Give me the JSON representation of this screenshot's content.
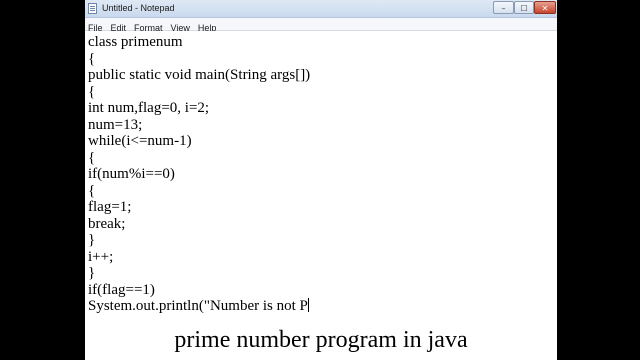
{
  "window": {
    "title": "Untitled - Notepad",
    "controls": {
      "minimize": "–",
      "maximize": "☐",
      "close": "✕"
    }
  },
  "menu": [
    "File",
    "Edit",
    "Format",
    "View",
    "Help"
  ],
  "editor": {
    "lines": [
      "class primenum",
      "{",
      "public static void main(String args[])",
      "{",
      "int num,flag=0, i=2;",
      "num=13;",
      "while(i<=num-1)",
      "{",
      "if(num%i==0)",
      "{",
      "flag=1;",
      "break;",
      "}",
      "i++;",
      "}",
      "if(flag==1)",
      "System.out.println(\"Number is not P"
    ]
  },
  "caption": "prime number program in java",
  "colors": {
    "background": "#000000",
    "page": "#ffffff",
    "text": "#000000"
  }
}
